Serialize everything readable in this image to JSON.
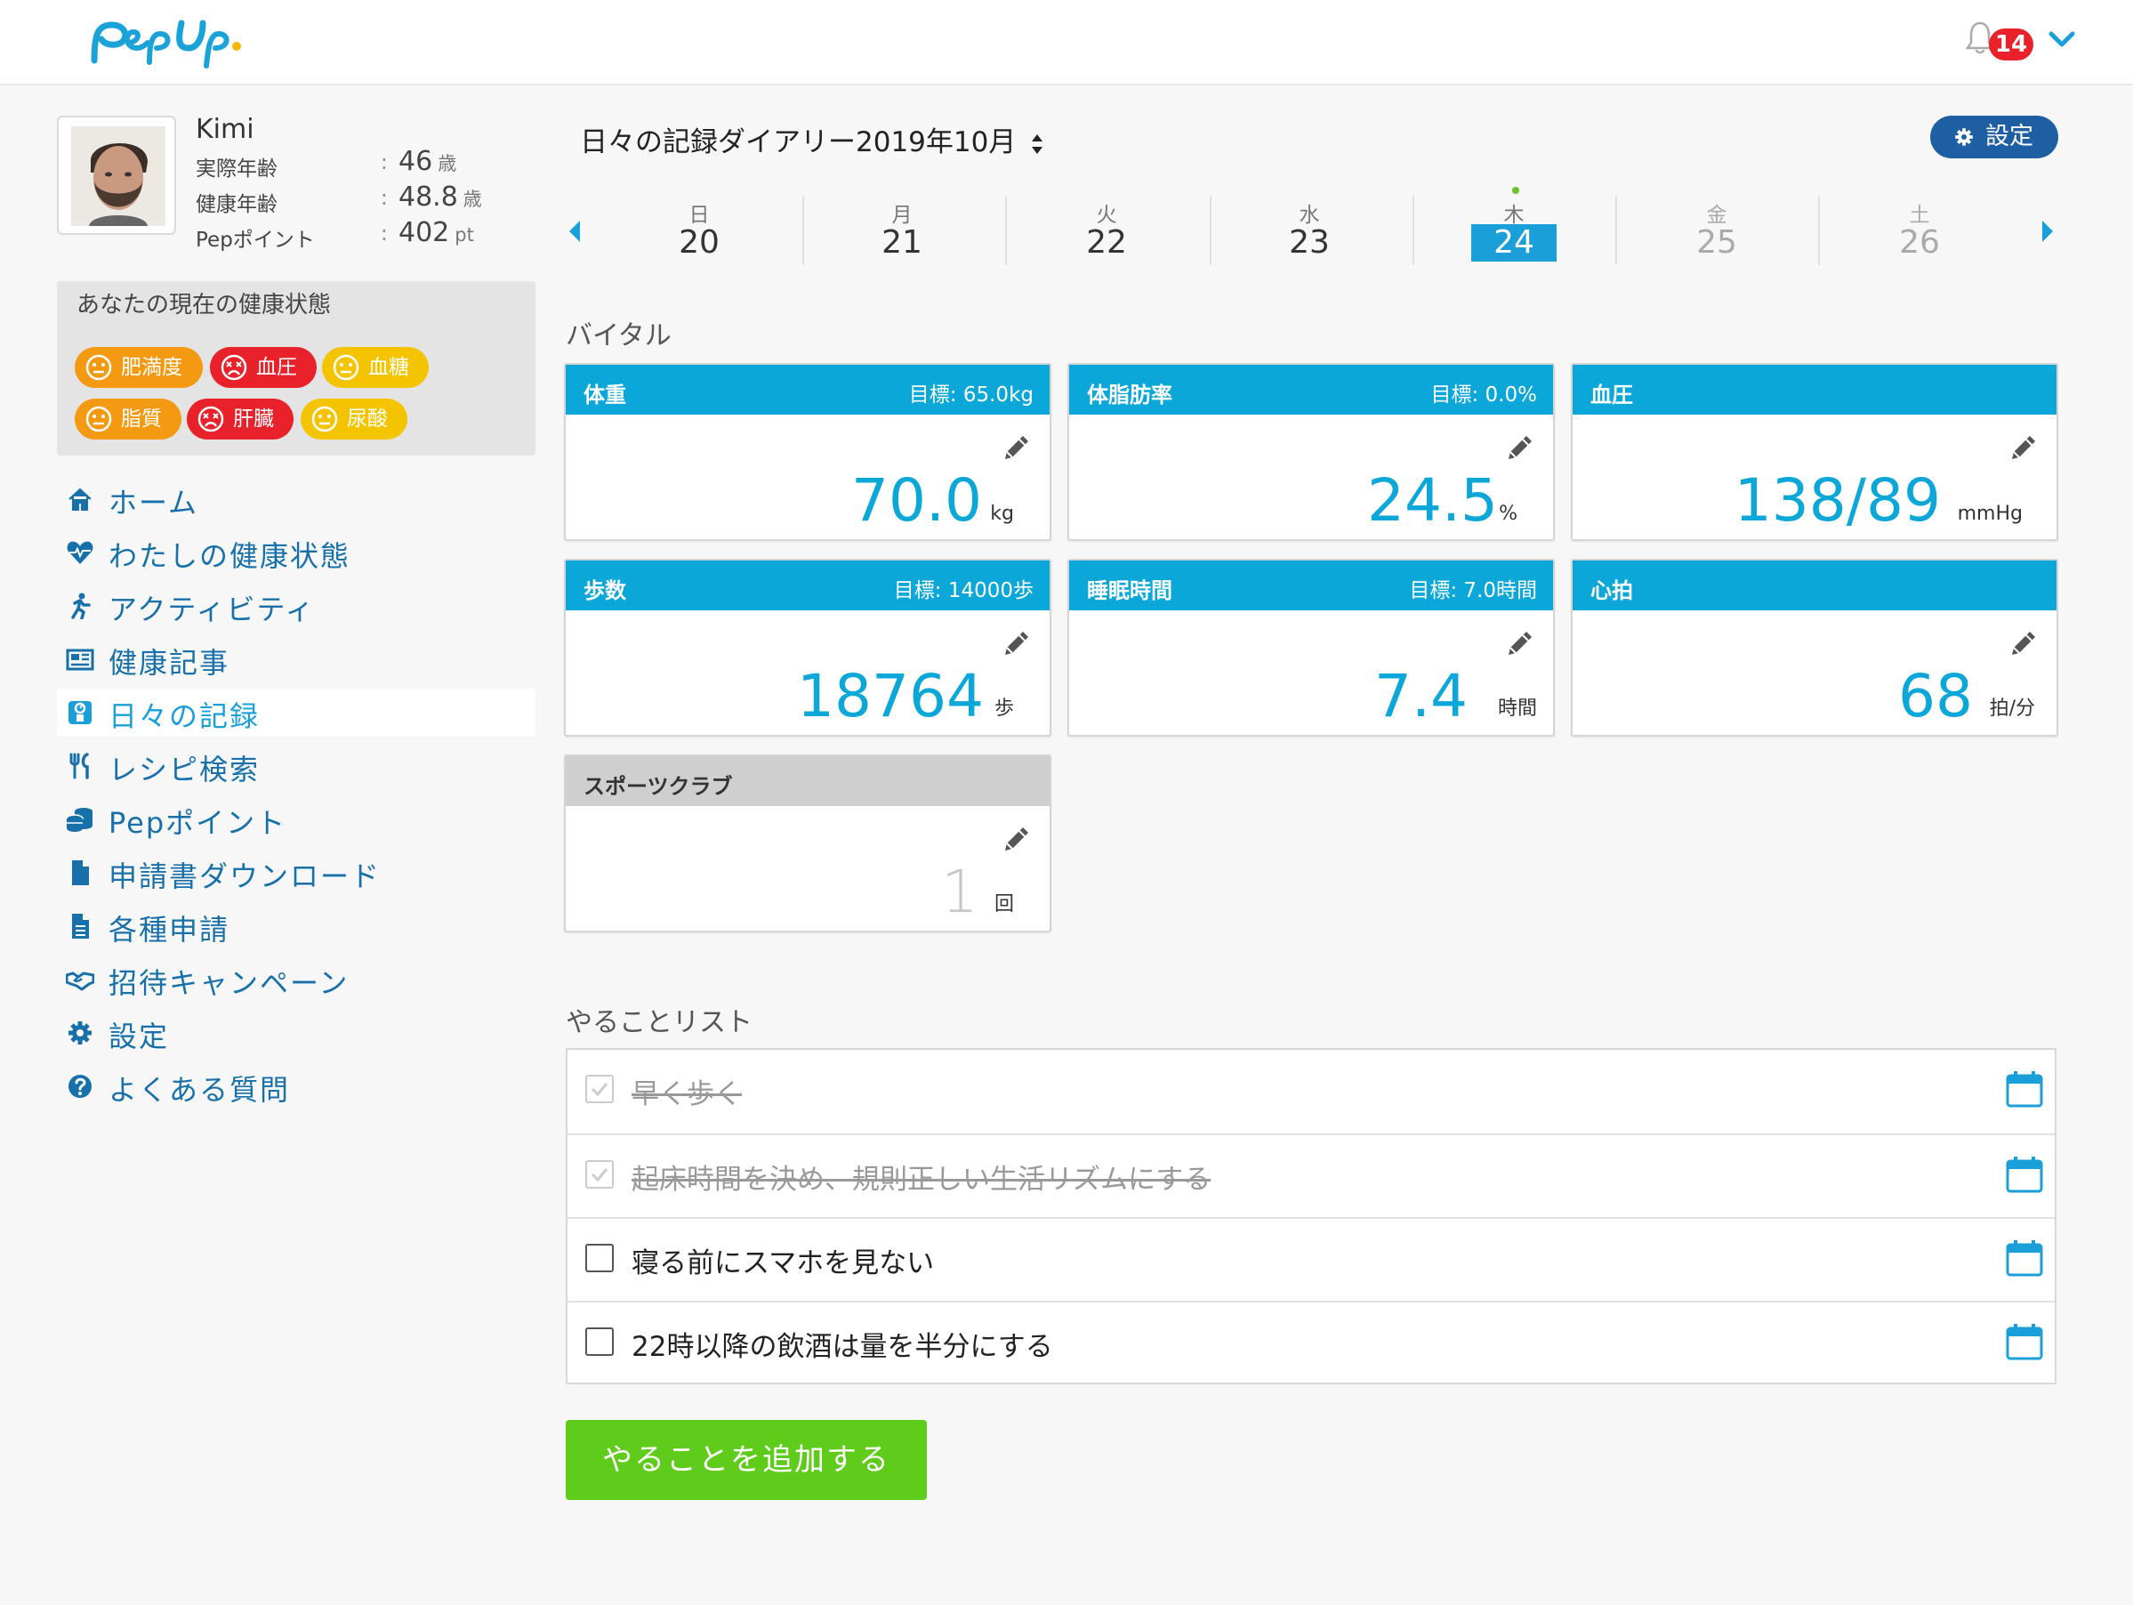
{
  "header": {
    "logo_text": "PepUp",
    "notification_count": "14"
  },
  "profile": {
    "name": "Kimi",
    "rows": [
      {
        "label": "実際年齢",
        "value": "46",
        "unit": "歳"
      },
      {
        "label": "健康年齢",
        "value": "48.8",
        "unit": "歳"
      },
      {
        "label": "Pepポイント",
        "value": "402",
        "unit": "pt"
      }
    ]
  },
  "health_status": {
    "title": "あなたの現在の健康状態",
    "items": [
      {
        "label": "肥満度",
        "status": "orange",
        "face": "neutral-face-icon"
      },
      {
        "label": "血圧",
        "status": "red",
        "face": "dizzy-face-icon"
      },
      {
        "label": "血糖",
        "status": "yellow",
        "face": "neutral-face-icon"
      },
      {
        "label": "脂質",
        "status": "orange",
        "face": "neutral-face-icon"
      },
      {
        "label": "肝臓",
        "status": "red",
        "face": "dizzy-face-icon"
      },
      {
        "label": "尿酸",
        "status": "yellow",
        "face": "neutral-face-icon"
      }
    ],
    "colors": {
      "orange": "#f39a12",
      "red": "#e8212a",
      "yellow": "#f5c400"
    }
  },
  "sidebar": {
    "items": [
      {
        "label": "ホーム",
        "icon": "home-icon"
      },
      {
        "label": "わたしの健康状態",
        "icon": "heartbeat-icon"
      },
      {
        "label": "アクティビティ",
        "icon": "running-icon"
      },
      {
        "label": "健康記事",
        "icon": "newspaper-icon"
      },
      {
        "label": "日々の記録",
        "icon": "scale-icon",
        "active": true
      },
      {
        "label": "レシピ検索",
        "icon": "utensils-icon"
      },
      {
        "label": "Pepポイント",
        "icon": "coins-icon"
      },
      {
        "label": "申請書ダウンロード",
        "icon": "file-icon"
      },
      {
        "label": "各種申請",
        "icon": "file-text-icon"
      },
      {
        "label": "招待キャンペーン",
        "icon": "handshake-icon"
      },
      {
        "label": "設定",
        "icon": "gear-icon"
      },
      {
        "label": "よくある質問",
        "icon": "question-circle-icon"
      }
    ],
    "accent_color": "#1770aa"
  },
  "diary": {
    "title": "日々の記録ダイアリー2019年10月",
    "settings_label": "設定",
    "week": [
      {
        "weekday": "日",
        "date": "20"
      },
      {
        "weekday": "月",
        "date": "21"
      },
      {
        "weekday": "火",
        "date": "22"
      },
      {
        "weekday": "水",
        "date": "23"
      },
      {
        "weekday": "木",
        "date": "24",
        "selected": true
      },
      {
        "weekday": "金",
        "date": "25",
        "future": true
      },
      {
        "weekday": "土",
        "date": "26",
        "future": true
      }
    ]
  },
  "vitals": {
    "section_title": "バイタル",
    "cards": [
      {
        "label": "体重",
        "goal": "目標: 65.0kg",
        "value": "70.0",
        "unit": "kg"
      },
      {
        "label": "体脂肪率",
        "goal": "目標: 0.0%",
        "value": "24.5",
        "unit": "%"
      },
      {
        "label": "血圧",
        "goal": "",
        "value": "138/89",
        "unit": "mmHg"
      },
      {
        "label": "歩数",
        "goal": "目標: 14000歩",
        "value": "18764",
        "unit": "歩"
      },
      {
        "label": "睡眠時間",
        "goal": "目標: 7.0時間",
        "value": "7.4",
        "unit": "時間"
      },
      {
        "label": "心拍",
        "goal": "",
        "value": "68",
        "unit": "拍/分"
      },
      {
        "label": "スポーツクラブ",
        "goal": "",
        "value": "1",
        "unit": "回"
      }
    ],
    "accent_color": "#0aa7d8"
  },
  "todo": {
    "section_title": "やることリスト",
    "items": [
      {
        "text": "早く歩く",
        "done": true
      },
      {
        "text": "起床時間を決め、規則正しい生活リズムにする",
        "done": true
      },
      {
        "text": "寝る前にスマホを見ない",
        "done": false
      },
      {
        "text": "22時以降の飲酒は量を半分にする",
        "done": false
      }
    ],
    "add_button_label": "やることを追加する",
    "add_button_color": "#5fcb1a"
  }
}
